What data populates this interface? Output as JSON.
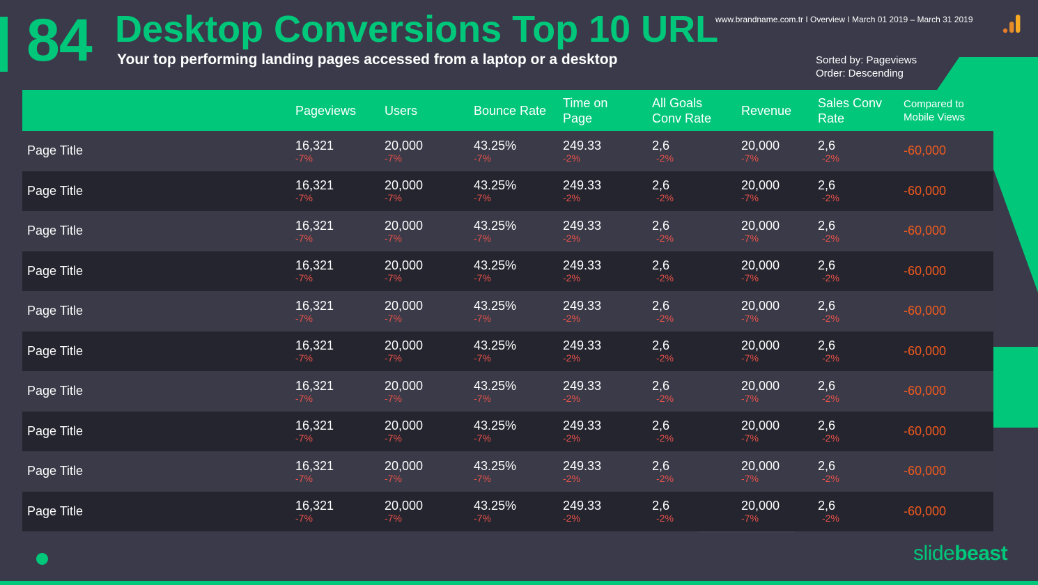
{
  "header": {
    "slide_number": "84",
    "title": "Desktop Conversions Top 10 URL",
    "subtitle": "Your top performing landing pages accessed from a laptop or a desktop",
    "meta_line": "www.brandname.com.tr I Overview I March 01 2019 – March 31 2019",
    "sorted_by": "Sorted by: Pageviews",
    "order": "Order: Descending",
    "logo_icon": "analytics-bars-icon"
  },
  "colors": {
    "accent": "#00c77a",
    "background": "#3a3a4a",
    "negative_delta": "#e8524a",
    "compare_value": "#f05a1e"
  },
  "table": {
    "columns": [
      {
        "line1": "",
        "line2": ""
      },
      {
        "line1": "Pageviews",
        "line2": ""
      },
      {
        "line1": "Users",
        "line2": ""
      },
      {
        "line1": "Bounce Rate",
        "line2": ""
      },
      {
        "line1": "Time on",
        "line2": "Page"
      },
      {
        "line1": "All Goals",
        "line2": "Conv Rate"
      },
      {
        "line1": "Revenue",
        "line2": ""
      },
      {
        "line1": "Sales Conv",
        "line2": "Rate"
      },
      {
        "line1": "Compared to",
        "line2": "Mobile Views"
      }
    ],
    "rows": [
      {
        "title": "Page Title",
        "pageviews": "16,321",
        "pageviews_delta": "-7%",
        "users": "20,000",
        "users_delta": "-7%",
        "bounce": "43.25%",
        "bounce_delta": "-7%",
        "time": "249.33",
        "time_delta": "-2%",
        "goals": "2,6",
        "goals_delta": "-2%",
        "revenue": "20,000",
        "revenue_delta": "-7%",
        "sales": "2,6",
        "sales_delta": "-2%",
        "compare": "-60,000"
      },
      {
        "title": "Page Title",
        "pageviews": "16,321",
        "pageviews_delta": "-7%",
        "users": "20,000",
        "users_delta": "-7%",
        "bounce": "43.25%",
        "bounce_delta": "-7%",
        "time": "249.33",
        "time_delta": "-2%",
        "goals": "2,6",
        "goals_delta": "-2%",
        "revenue": "20,000",
        "revenue_delta": "-7%",
        "sales": "2,6",
        "sales_delta": "-2%",
        "compare": "-60,000"
      },
      {
        "title": "Page Title",
        "pageviews": "16,321",
        "pageviews_delta": "-7%",
        "users": "20,000",
        "users_delta": "-7%",
        "bounce": "43.25%",
        "bounce_delta": "-7%",
        "time": "249.33",
        "time_delta": "-2%",
        "goals": "2,6",
        "goals_delta": "-2%",
        "revenue": "20,000",
        "revenue_delta": "-7%",
        "sales": "2,6",
        "sales_delta": "-2%",
        "compare": "-60,000"
      },
      {
        "title": "Page Title",
        "pageviews": "16,321",
        "pageviews_delta": "-7%",
        "users": "20,000",
        "users_delta": "-7%",
        "bounce": "43.25%",
        "bounce_delta": "-7%",
        "time": "249.33",
        "time_delta": "-2%",
        "goals": "2,6",
        "goals_delta": "-2%",
        "revenue": "20,000",
        "revenue_delta": "-7%",
        "sales": "2,6",
        "sales_delta": "-2%",
        "compare": "-60,000"
      },
      {
        "title": "Page Title",
        "pageviews": "16,321",
        "pageviews_delta": "-7%",
        "users": "20,000",
        "users_delta": "-7%",
        "bounce": "43.25%",
        "bounce_delta": "-7%",
        "time": "249.33",
        "time_delta": "-2%",
        "goals": "2,6",
        "goals_delta": "-2%",
        "revenue": "20,000",
        "revenue_delta": "-7%",
        "sales": "2,6",
        "sales_delta": "-2%",
        "compare": "-60,000"
      },
      {
        "title": "Page Title",
        "pageviews": "16,321",
        "pageviews_delta": "-7%",
        "users": "20,000",
        "users_delta": "-7%",
        "bounce": "43.25%",
        "bounce_delta": "-7%",
        "time": "249.33",
        "time_delta": "-2%",
        "goals": "2,6",
        "goals_delta": "-2%",
        "revenue": "20,000",
        "revenue_delta": "-7%",
        "sales": "2,6",
        "sales_delta": "-2%",
        "compare": "-60,000"
      },
      {
        "title": "Page Title",
        "pageviews": "16,321",
        "pageviews_delta": "-7%",
        "users": "20,000",
        "users_delta": "-7%",
        "bounce": "43.25%",
        "bounce_delta": "-7%",
        "time": "249.33",
        "time_delta": "-2%",
        "goals": "2,6",
        "goals_delta": "-2%",
        "revenue": "20,000",
        "revenue_delta": "-7%",
        "sales": "2,6",
        "sales_delta": "-2%",
        "compare": "-60,000"
      },
      {
        "title": "Page Title",
        "pageviews": "16,321",
        "pageviews_delta": "-7%",
        "users": "20,000",
        "users_delta": "-7%",
        "bounce": "43.25%",
        "bounce_delta": "-7%",
        "time": "249.33",
        "time_delta": "-2%",
        "goals": "2,6",
        "goals_delta": "-2%",
        "revenue": "20,000",
        "revenue_delta": "-7%",
        "sales": "2,6",
        "sales_delta": "-2%",
        "compare": "-60,000"
      },
      {
        "title": "Page Title",
        "pageviews": "16,321",
        "pageviews_delta": "-7%",
        "users": "20,000",
        "users_delta": "-7%",
        "bounce": "43.25%",
        "bounce_delta": "-7%",
        "time": "249.33",
        "time_delta": "-2%",
        "goals": "2,6",
        "goals_delta": "-2%",
        "revenue": "20,000",
        "revenue_delta": "-7%",
        "sales": "2,6",
        "sales_delta": "-2%",
        "compare": "-60,000"
      },
      {
        "title": "Page Title",
        "pageviews": "16,321",
        "pageviews_delta": "-7%",
        "users": "20,000",
        "users_delta": "-7%",
        "bounce": "43.25%",
        "bounce_delta": "-7%",
        "time": "249.33",
        "time_delta": "-2%",
        "goals": "2,6",
        "goals_delta": "-2%",
        "revenue": "20,000",
        "revenue_delta": "-7%",
        "sales": "2,6",
        "sales_delta": "-2%",
        "compare": "-60,000"
      }
    ]
  },
  "footer": {
    "brand_light": "slide",
    "brand_bold": "beast"
  }
}
